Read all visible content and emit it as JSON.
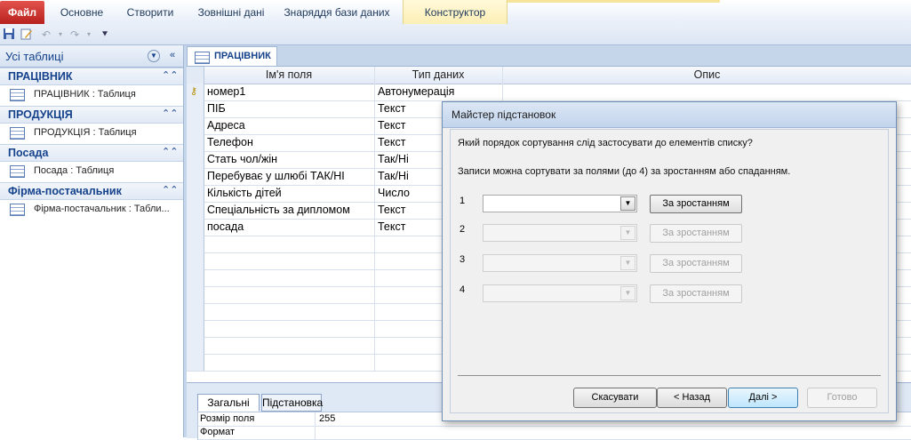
{
  "ribbon": {
    "file_tab": "Файл",
    "tabs": [
      "Основне",
      "Створити",
      "Зовнішні дані",
      "Знаряддя бази даних",
      "Конструктор"
    ]
  },
  "nav": {
    "title": "Усі таблиці",
    "groups": [
      {
        "title": "ПРАЦІВНИК",
        "item": "ПРАЦІВНИК : Таблиця"
      },
      {
        "title": "ПРОДУКЦІЯ",
        "item": "ПРОДУКЦІЯ : Таблиця"
      },
      {
        "title": "Посада",
        "item": "Посада : Таблиця"
      },
      {
        "title": "Фірма-постачальник",
        "item": "Фірма-постачальник : Табли..."
      }
    ]
  },
  "document": {
    "tab": "ПРАЦІВНИК",
    "columns": {
      "field": "Ім'я поля",
      "type": "Тип даних",
      "desc": "Опис"
    },
    "rows": [
      {
        "field": "номер1",
        "type": "Автонумерація"
      },
      {
        "field": "ПІБ",
        "type": "Текст"
      },
      {
        "field": "Адреса",
        "type": "Текст"
      },
      {
        "field": "Телефон",
        "type": "Текст"
      },
      {
        "field": "Стать чол/жін",
        "type": "Так/Ні"
      },
      {
        "field": "Перебуває у шлюбі ТАК/НІ",
        "type": "Так/Ні"
      },
      {
        "field": "Кількість дітей",
        "type": "Число"
      },
      {
        "field": "Спеціальність за дипломом",
        "type": "Текст"
      },
      {
        "field": "посада",
        "type": "Текст"
      }
    ]
  },
  "properties": {
    "tabs": [
      "Загальні",
      "Підстановка"
    ],
    "rows": [
      {
        "name": "Розмір поля",
        "value": "255"
      },
      {
        "name": "Формат",
        "value": ""
      }
    ]
  },
  "dialog": {
    "title": "Майстер підстановок",
    "question": "Який порядок сортування слід застосувати до елементів списку?",
    "hint": "Записи можна сортувати за полями (до 4) за зростанням або спаданням.",
    "sort_rows": [
      {
        "num": "1",
        "button": "За зростанням"
      },
      {
        "num": "2",
        "button": "За зростанням"
      },
      {
        "num": "3",
        "button": "За зростанням"
      },
      {
        "num": "4",
        "button": "За зростанням"
      }
    ],
    "buttons": {
      "cancel": "Скасувати",
      "back": "< Назад",
      "next": "Далі >",
      "finish": "Готово"
    }
  }
}
